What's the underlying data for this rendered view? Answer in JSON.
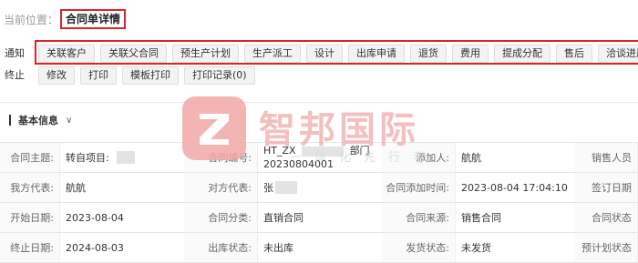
{
  "breadcrumb": {
    "label": "当前位置：",
    "current": "合同单详情"
  },
  "toolbar_row1": [
    "通知",
    "关联客户",
    "关联父合同",
    "预生产计划",
    "生产派工",
    "设计",
    "出库申请",
    "退货",
    "费用",
    "提成分配",
    "售后",
    "洽谈进展"
  ],
  "toolbar_row2": [
    "终止",
    "修改",
    "打印",
    "模板打印",
    "打印记录(0)"
  ],
  "section": {
    "title": "基本信息",
    "toggle": "∨"
  },
  "watermark": {
    "brand": "智邦国际",
    "sub": "一体化先行者"
  },
  "rows": [
    {
      "c1": {
        "label": "合同主题:",
        "value": "转自项目:"
      },
      "c2": {
        "label": "合同编号:",
        "value": "HT_ZX",
        "value_tail": "部门",
        "value_line2": "20230804001"
      },
      "c3": {
        "label": "添加人:",
        "value": "航航"
      },
      "c4": {
        "label": "销售人员"
      }
    },
    {
      "c1": {
        "label": "我方代表:",
        "value": "航航"
      },
      "c2": {
        "label": "对方代表:",
        "value": "张"
      },
      "c3": {
        "label": "合同添加时间:",
        "value": "2023-08-04 17:04:10"
      },
      "c4": {
        "label": "签订日期"
      }
    },
    {
      "c1": {
        "label": "开始日期:",
        "value": "2023-08-04"
      },
      "c2": {
        "label": "合同分类:",
        "value": "直销合同"
      },
      "c3": {
        "label": "合同来源:",
        "value": "销售合同"
      },
      "c4": {
        "label": "合同状态"
      }
    },
    {
      "c1": {
        "label": "终止日期:",
        "value": "2024-08-03"
      },
      "c2": {
        "label": "出库状态:",
        "value": "未出库"
      },
      "c3": {
        "label": "发货状态:",
        "value": "未发货"
      },
      "c4": {
        "label": "预计划状态"
      }
    }
  ],
  "colors": {
    "highlight_frame": "#d9262c",
    "label_bg": "#fafafa",
    "button_bg": "#f3f3f3"
  }
}
